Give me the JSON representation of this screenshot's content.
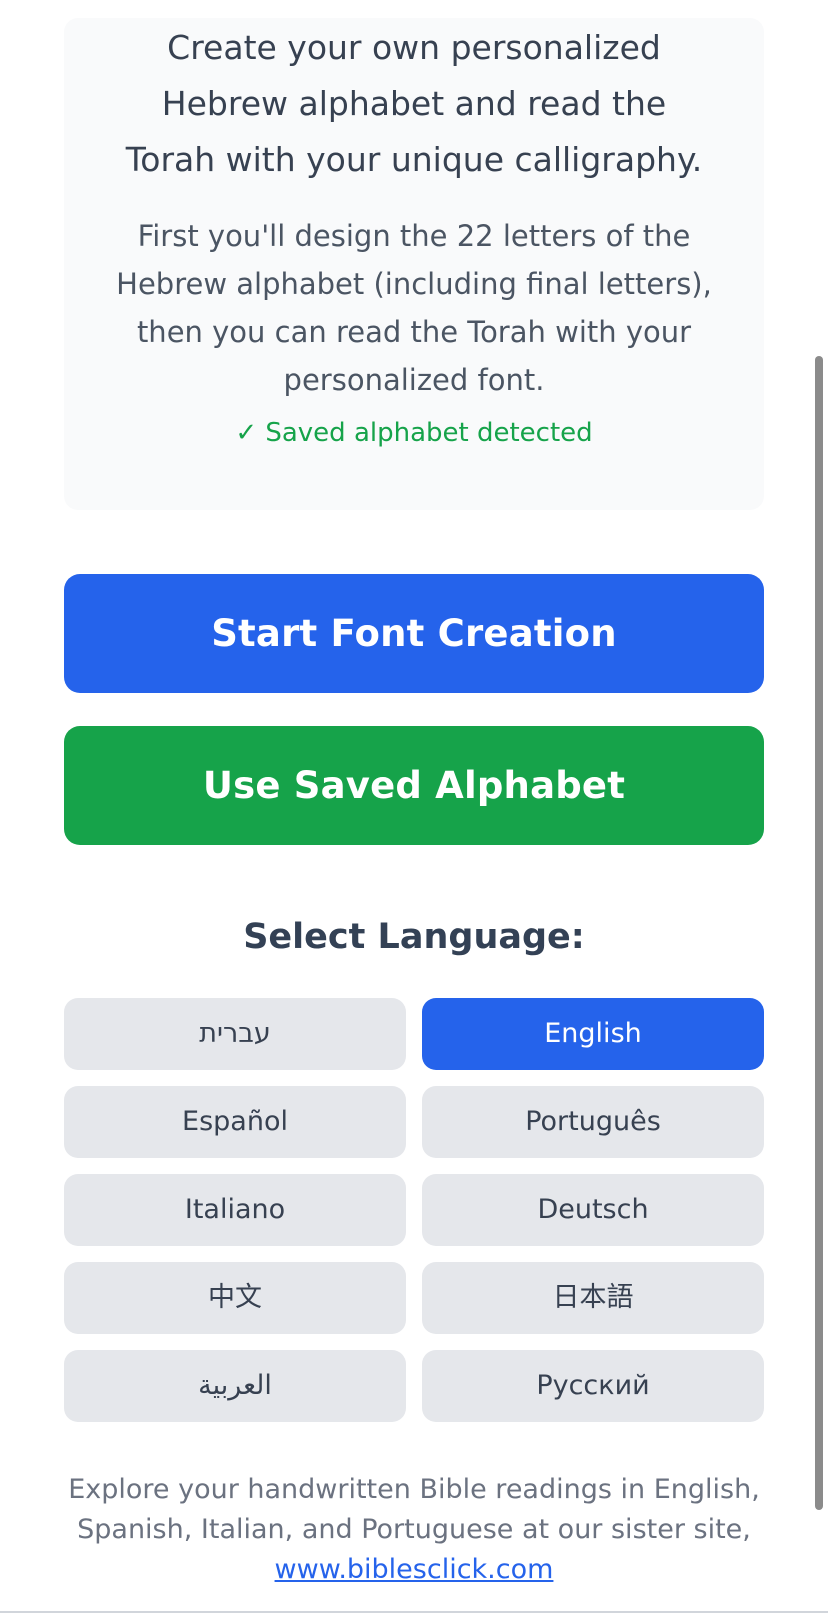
{
  "intro": {
    "headline": "Create your own personalized Hebrew alphabet and read the Torah with your unique calligraphy.",
    "description": "First you'll design the 22 letters of the Hebrew alphabet (including final letters), then you can read the Torah with your personalized font.",
    "saved_status": "✓ Saved alphabet detected"
  },
  "actions": {
    "start_label": "Start Font Creation",
    "saved_label": "Use Saved Alphabet"
  },
  "language": {
    "heading": "Select Language:",
    "selected": "English",
    "options": [
      {
        "label": "עברית"
      },
      {
        "label": "English"
      },
      {
        "label": "Español"
      },
      {
        "label": "Português"
      },
      {
        "label": "Italiano"
      },
      {
        "label": "Deutsch"
      },
      {
        "label": "中文"
      },
      {
        "label": "日本語"
      },
      {
        "label": "العربية"
      },
      {
        "label": "Русский"
      }
    ]
  },
  "footer": {
    "text": "Explore your handwritten Bible readings in English, Spanish, Italian, and Portuguese at our sister site,",
    "link_text": "www.biblesclick.com"
  },
  "colors": {
    "primary": "#2563eb",
    "success": "#16a34a",
    "card_background": "#f9fafb",
    "button_background": "#e5e7eb"
  }
}
